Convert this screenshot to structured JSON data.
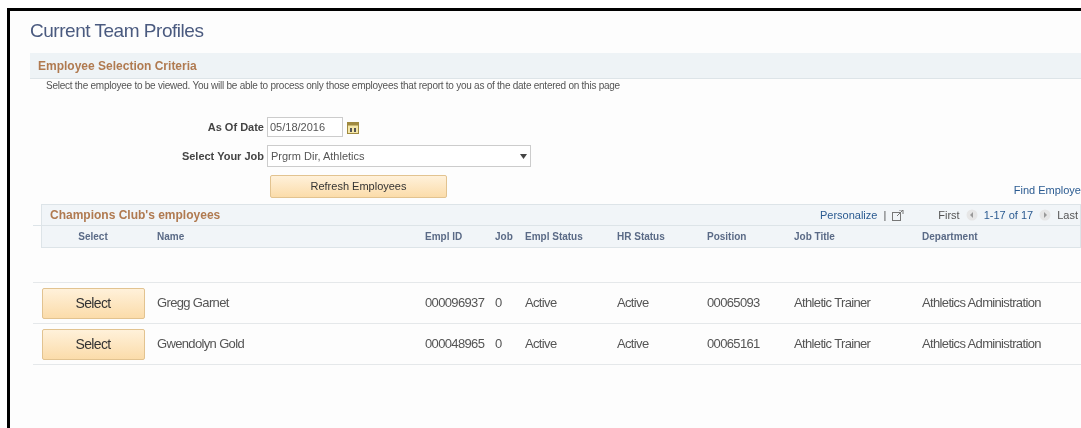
{
  "page_title": "Current Team Profiles",
  "criteria": {
    "title": "Employee Selection Criteria",
    "instructions": "Select the employee to be viewed. You will be able to process only those employees that report to you as of the date entered on this page",
    "as_of_date": {
      "label": "As Of Date",
      "value": "05/18/2016"
    },
    "job": {
      "label": "Select Your Job",
      "value": "Prgrm Dir, Athletics"
    },
    "refresh_button": "Refresh Employees",
    "find_link": "Find Employe"
  },
  "grid": {
    "title": "Champions Club's employees",
    "personalize": "Personalize",
    "separator": "|",
    "first": "First",
    "range": "1-17 of 17",
    "last": "Last",
    "columns": [
      "Select",
      "Name",
      "Empl ID",
      "Job",
      "Empl Status",
      "HR Status",
      "Position",
      "Job Title",
      "Department"
    ],
    "rows": [
      {
        "cells": [
          "Select",
          "Gregg Garnet",
          "000096937",
          "0",
          "Active",
          "Active",
          "00065093",
          "Athletic Trainer",
          "Athletics Administration"
        ]
      },
      {
        "cells": [
          "Select",
          "Gwendolyn Gold",
          "000048965",
          "0",
          "Active",
          "Active",
          "00065161",
          "Athletic Trainer",
          "Athletics Administration"
        ]
      }
    ]
  }
}
